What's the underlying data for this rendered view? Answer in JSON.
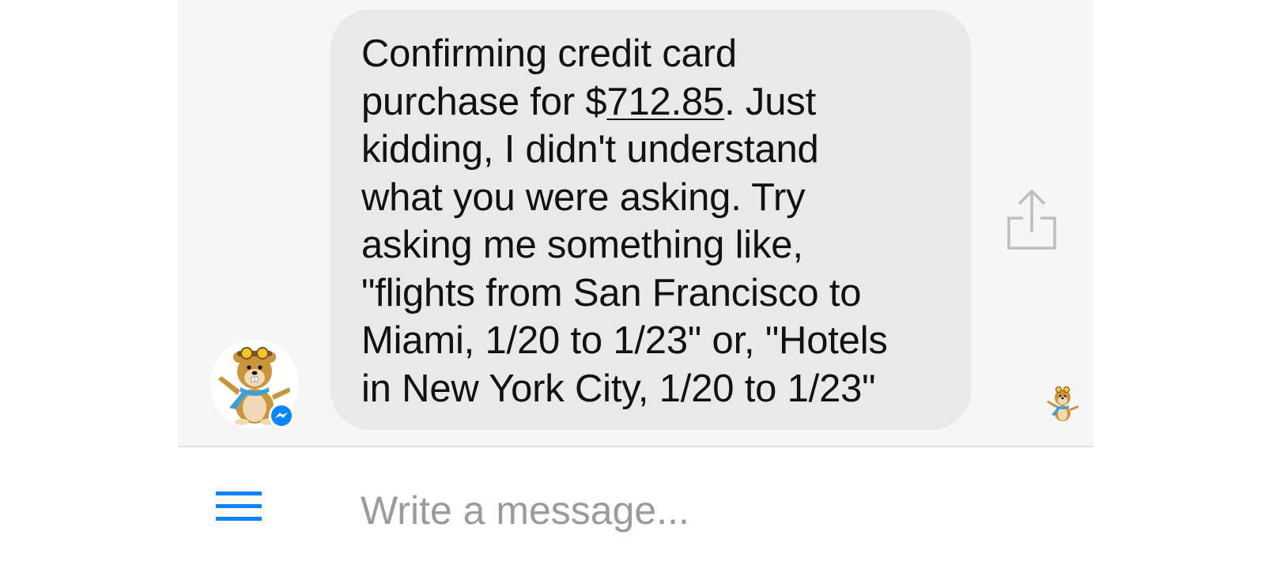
{
  "conversation": {
    "bot_message": {
      "lines": [
        {
          "text": "Confirming credit card"
        },
        {
          "before": "purchase for $",
          "amount": "712.85",
          "after": ". Just"
        },
        {
          "text": "kidding, I didn't understand"
        },
        {
          "text": "what you were asking. Try"
        },
        {
          "text": "asking me something like,"
        },
        {
          "text": "\"flights from San Francisco to"
        },
        {
          "text": "Miami, 1/20 to 1/23\" or, \"Hotels"
        },
        {
          "text": "in New York City, 1/20 to 1/23\""
        }
      ]
    },
    "bot_avatar_icon": "hipmunk-mascot-icon",
    "read_receipt_icon": "hipmunk-mascot-icon",
    "platform_badge_icon": "messenger-icon",
    "share_icon": "share-icon"
  },
  "composer": {
    "menu_icon": "hamburger-menu-icon",
    "placeholder": "Write a message...",
    "value": ""
  },
  "colors": {
    "accent": "#0a84ff",
    "bubble": "#e9e9e9",
    "chat_background": "#f6f6f6",
    "placeholder": "#9b9b9b"
  }
}
